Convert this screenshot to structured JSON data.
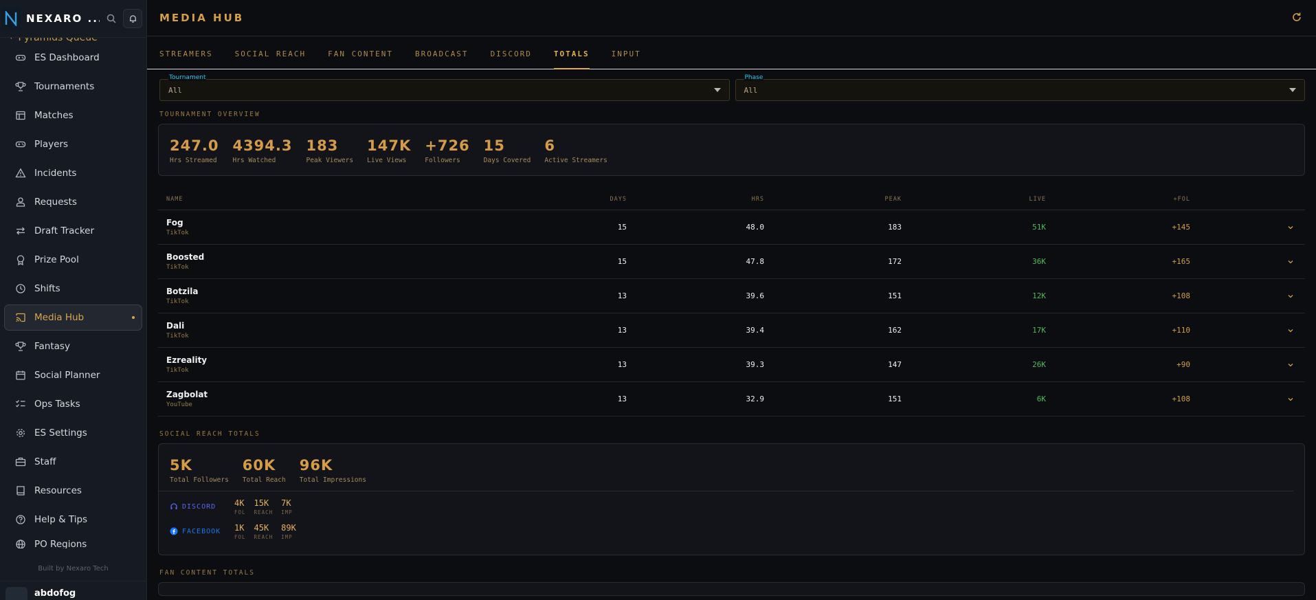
{
  "brand": {
    "name": "NEXARO ..."
  },
  "sidebar": {
    "group_label": "Pyramids Queue",
    "items": [
      {
        "label": "ES Dashboard",
        "icon": "gamepad-icon"
      },
      {
        "label": "Tournaments",
        "icon": "trophy-icon"
      },
      {
        "label": "Matches",
        "icon": "table-icon"
      },
      {
        "label": "Players",
        "icon": "gamepad-icon"
      },
      {
        "label": "Incidents",
        "icon": "warning-icon"
      },
      {
        "label": "Requests",
        "icon": "user-icon"
      },
      {
        "label": "Draft Tracker",
        "icon": "swap-icon"
      },
      {
        "label": "Prize Pool",
        "icon": "medal-icon"
      },
      {
        "label": "Shifts",
        "icon": "clock-icon"
      },
      {
        "label": "Media Hub",
        "icon": "cast-icon",
        "active": true
      },
      {
        "label": "Fantasy",
        "icon": "trophy-icon"
      },
      {
        "label": "Social Planner",
        "icon": "calendar-icon"
      },
      {
        "label": "Ops Tasks",
        "icon": "checklist-icon"
      },
      {
        "label": "ES Settings",
        "icon": "gear-icon"
      },
      {
        "label": "Staff",
        "icon": "briefcase-icon"
      },
      {
        "label": "Resources",
        "icon": "book-icon"
      },
      {
        "label": "Help & Tips",
        "icon": "help-icon"
      },
      {
        "label": "PO Regions",
        "icon": "globe-icon"
      }
    ],
    "built_by": "Built by Nexaro Tech",
    "user": "abdofog"
  },
  "header": {
    "title": "MEDIA HUB"
  },
  "tabs": [
    "STREAMERS",
    "SOCIAL REACH",
    "FAN CONTENT",
    "BROADCAST",
    "DISCORD",
    "TOTALS",
    "INPUT"
  ],
  "active_tab": "TOTALS",
  "filters": {
    "tournament": {
      "label": "Tournament",
      "value": "All"
    },
    "phase": {
      "label": "Phase",
      "value": "All"
    }
  },
  "overview": {
    "label": "TOURNAMENT OVERVIEW",
    "stats": [
      {
        "value": "247.0",
        "label": "Hrs Streamed"
      },
      {
        "value": "4394.3",
        "label": "Hrs Watched"
      },
      {
        "value": "183",
        "label": "Peak Viewers"
      },
      {
        "value": "147K",
        "label": "Live Views"
      },
      {
        "value": "+726",
        "label": "Followers"
      },
      {
        "value": "15",
        "label": "Days Covered"
      },
      {
        "value": "6",
        "label": "Active Streamers"
      }
    ]
  },
  "table": {
    "headers": [
      "NAME",
      "DAYS",
      "HRS",
      "PEAK",
      "LIVE",
      "+FOL"
    ],
    "rows": [
      {
        "name": "Fog",
        "platform": "TikTok",
        "days": "15",
        "hrs": "48.0",
        "peak": "183",
        "live": "51K",
        "fol": "+145"
      },
      {
        "name": "Boosted",
        "platform": "TikTok",
        "days": "15",
        "hrs": "47.8",
        "peak": "172",
        "live": "36K",
        "fol": "+165"
      },
      {
        "name": "Botzila",
        "platform": "TikTok",
        "days": "13",
        "hrs": "39.6",
        "peak": "151",
        "live": "12K",
        "fol": "+108"
      },
      {
        "name": "Dali",
        "platform": "TikTok",
        "days": "13",
        "hrs": "39.4",
        "peak": "162",
        "live": "17K",
        "fol": "+110"
      },
      {
        "name": "Ezreality",
        "platform": "TikTok",
        "days": "13",
        "hrs": "39.3",
        "peak": "147",
        "live": "26K",
        "fol": "+90"
      },
      {
        "name": "Zagbolat",
        "platform": "YouTube",
        "days": "13",
        "hrs": "32.9",
        "peak": "151",
        "live": "6K",
        "fol": "+108"
      }
    ]
  },
  "social": {
    "label": "SOCIAL REACH TOTALS",
    "stats": [
      {
        "value": "5K",
        "label": "Total Followers"
      },
      {
        "value": "60K",
        "label": "Total Reach"
      },
      {
        "value": "96K",
        "label": "Total Impressions"
      }
    ],
    "channels": [
      {
        "name": "DISCORD",
        "color": "#5865f2",
        "metrics": [
          {
            "v": "4K",
            "l": "FOL"
          },
          {
            "v": "15K",
            "l": "REACH"
          },
          {
            "v": "7K",
            "l": "IMP"
          }
        ]
      },
      {
        "name": "FACEBOOK",
        "color": "#1877f2",
        "metrics": [
          {
            "v": "1K",
            "l": "FOL"
          },
          {
            "v": "45K",
            "l": "REACH"
          },
          {
            "v": "89K",
            "l": "IMP"
          }
        ]
      }
    ]
  },
  "fan_content": {
    "label": "FAN CONTENT TOTALS"
  },
  "colors": {
    "accent": "#d39f4a",
    "live": "#55b85c",
    "filter_label": "#2ec8e8"
  }
}
